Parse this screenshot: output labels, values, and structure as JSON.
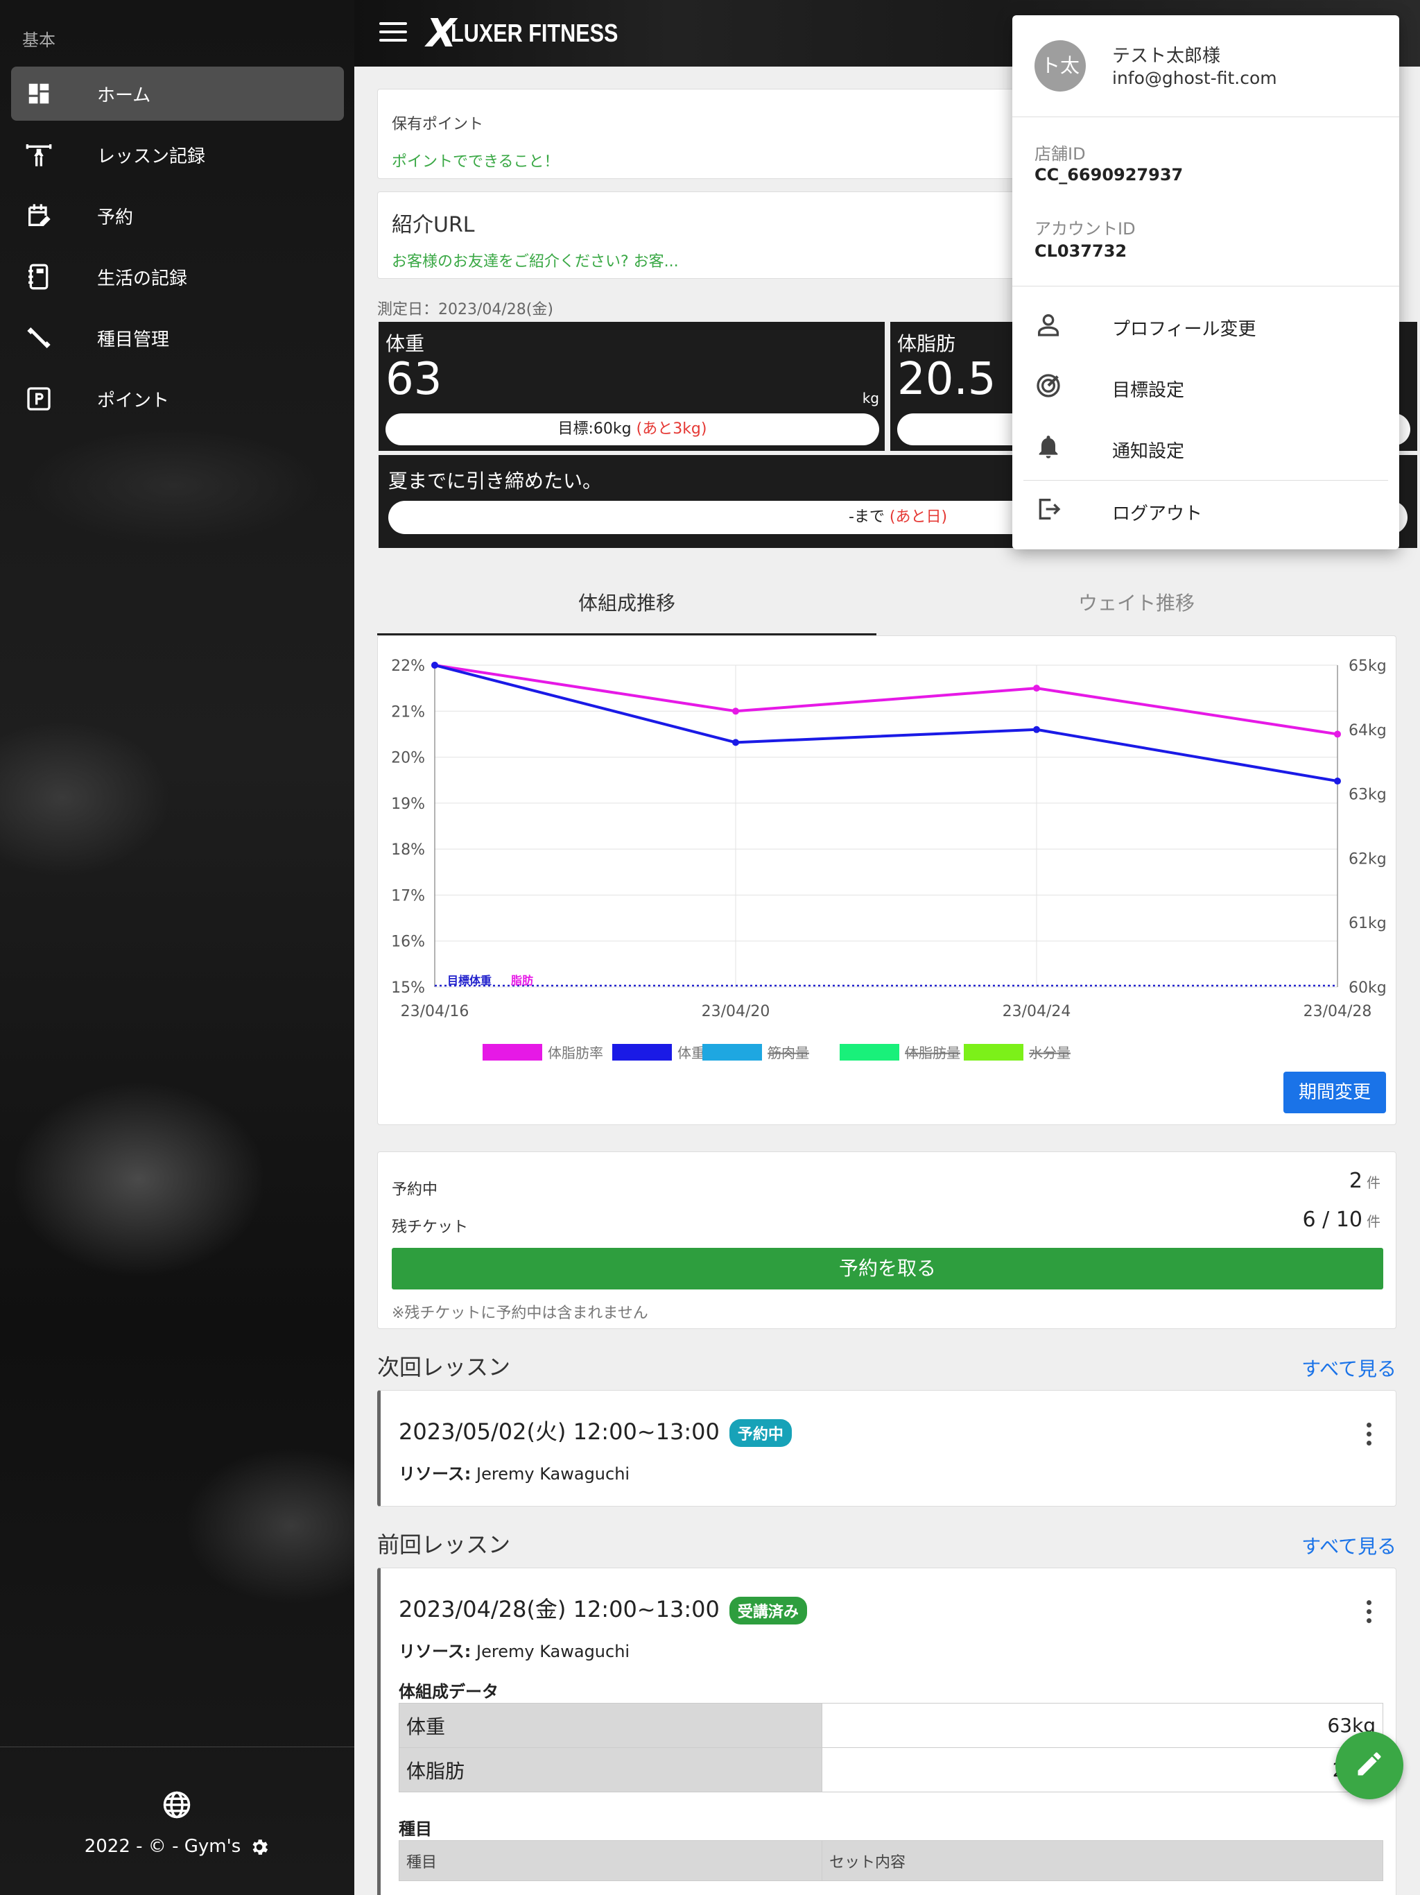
{
  "sidebar": {
    "section_label": "基本",
    "items": [
      {
        "label": "ホーム",
        "icon": "dashboard-icon",
        "active": true
      },
      {
        "label": "レッスン記録",
        "icon": "weightlifter-icon"
      },
      {
        "label": "予約",
        "icon": "calendar-edit-icon"
      },
      {
        "label": "生活の記録",
        "icon": "notebook-icon"
      },
      {
        "label": "種目管理",
        "icon": "dumbbell-icon"
      },
      {
        "label": "ポイント",
        "icon": "parking-p-icon"
      }
    ],
    "footer": {
      "copyright": "2022 - © - Gym's",
      "globe_icon": "globe-icon",
      "settings_icon": "gear-icon"
    }
  },
  "header": {
    "logo_mark": "X",
    "logo_text": "LUXER FITNESS"
  },
  "points": {
    "label": "保有ポイント",
    "link": "ポイントでできること！"
  },
  "referral": {
    "title": "紹介URL",
    "link": "お客様のお友達をご紹介ください? お客..."
  },
  "measurement": {
    "date_label": "測定日：2023/04/28(金)",
    "weight": {
      "label": "体重",
      "value": "63",
      "unit": "kg",
      "goal_prefix": "目標:60kg ",
      "goal_remaining": "(あと3kg)"
    },
    "body_fat": {
      "label": "体脂肪",
      "value": "20.5"
    }
  },
  "goal": {
    "text": "夏までに引き締めたい。",
    "until_prefix": "-まで ",
    "until_remaining": "(あと日)"
  },
  "tabs": [
    {
      "label": "体組成推移",
      "active": true
    },
    {
      "label": "ウェイト推移",
      "active": false
    }
  ],
  "chart_data": {
    "type": "line",
    "x": [
      "23/04/16",
      "23/04/20",
      "23/04/24",
      "23/04/28"
    ],
    "y_left_ticks": [
      "22%",
      "21%",
      "20%",
      "19%",
      "18%",
      "17%",
      "16%",
      "15%"
    ],
    "y_right_ticks": [
      "65kg",
      "64kg",
      "63kg",
      "62kg",
      "61kg",
      "60kg"
    ],
    "y_left_range": [
      15,
      22
    ],
    "y_right_range": [
      60,
      65
    ],
    "series": [
      {
        "name": "体脂肪率",
        "axis": "left",
        "color": "#e619e6",
        "values": [
          22,
          21,
          21.5,
          20.5
        ],
        "hidden": false
      },
      {
        "name": "体重",
        "axis": "right",
        "color": "#1a1ae6",
        "values": [
          65,
          63.8,
          64,
          63.2
        ],
        "hidden": false
      },
      {
        "name": "筋肉量",
        "axis": "left",
        "color": "#1ea7e1",
        "values": [],
        "hidden": true
      },
      {
        "name": "体脂肪量",
        "axis": "left",
        "color": "#19f07a",
        "values": [],
        "hidden": true
      },
      {
        "name": "水分量",
        "axis": "left",
        "color": "#7cf019",
        "values": [],
        "hidden": true
      }
    ],
    "target_line": {
      "label_a": "目標体重",
      "label_b": "脂肪",
      "value_kg": 60
    },
    "grid": true
  },
  "chart_button": "期間変更",
  "booking": {
    "reserved_label": "予約中",
    "reserved_count": "2",
    "tickets_label": "残チケット",
    "tickets_value": "6 / 10",
    "count_unit": "件",
    "book_button": "予約を取る",
    "note": "※残チケットに予約中は含まれません"
  },
  "next_lesson": {
    "section_title": "次回レッスン",
    "see_all": "すべて見る",
    "datetime": "2023/05/02(火) 12:00~13:00",
    "badge": "予約中",
    "resource_label": "リソース:",
    "resource_value": "Jeremy Kawaguchi"
  },
  "prev_lesson": {
    "section_title": "前回レッスン",
    "see_all": "すべて見る",
    "datetime": "2023/04/28(金) 12:00~13:00",
    "badge": "受講済み",
    "resource_label": "リソース:",
    "resource_value": "Jeremy Kawaguchi",
    "body_comp_title": "体組成データ",
    "body_comp_rows": [
      {
        "key": "体重",
        "value": "63kg"
      },
      {
        "key": "体脂肪",
        "value": "20.5"
      }
    ],
    "exercise_title": "種目",
    "exercise_headers": [
      "種目",
      "セット内容"
    ]
  },
  "fab_icon": "pencil-icon",
  "account_menu": {
    "avatar_text": "ト太",
    "name": "テスト太郎様",
    "email": "info@ghost-fit.com",
    "store_id_label": "店舗ID",
    "store_id": "CC_6690927937",
    "account_id_label": "アカウントID",
    "account_id": "CL037732",
    "items": [
      {
        "label": "プロフィール変更",
        "icon": "person-icon"
      },
      {
        "label": "目標設定",
        "icon": "target-icon"
      },
      {
        "label": "通知設定",
        "icon": "bell-icon"
      },
      {
        "label": "ログアウト",
        "icon": "logout-icon"
      }
    ]
  }
}
